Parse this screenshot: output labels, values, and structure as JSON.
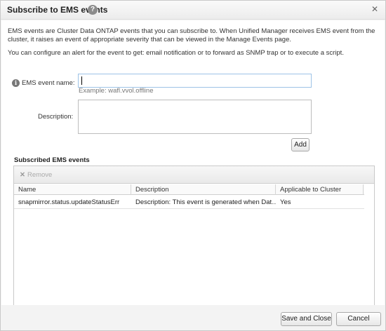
{
  "dialog": {
    "title": "Subscribe to EMS events",
    "help_icon": "question-circle-icon",
    "close_icon": "close-icon",
    "close_glyph": "✕"
  },
  "intro": {
    "paragraph1": "EMS events are Cluster Data ONTAP events that you can subscribe to. When Unified Manager receives EMS event from the cluster, it raises an event of appropriate severity that can be viewed in the Manage Events page.",
    "paragraph2": "You can configure an alert for the event to get: email notification or to forward as SNMP trap or to execute a script."
  },
  "form": {
    "name_label": "EMS event name:",
    "name_value": "",
    "name_example": "Example: wafl.vvol.offline",
    "description_label": "Description:",
    "description_value": "",
    "add_label": "Add"
  },
  "subscribed": {
    "title": "Subscribed EMS events",
    "remove_label": "Remove",
    "columns": [
      "Name",
      "Description",
      "Applicable to Cluster"
    ],
    "rows": [
      {
        "name": "snapmirror.status.updateStatusErr",
        "description": "Description: This event is generated when Dat…",
        "applicable": "Yes"
      }
    ]
  },
  "footer": {
    "save_label": "Save and Close",
    "cancel_label": "Cancel"
  }
}
